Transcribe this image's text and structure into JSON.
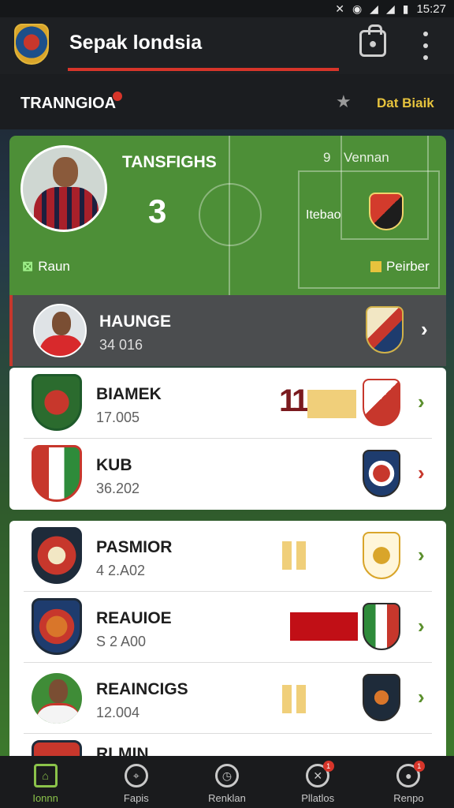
{
  "status_bar": {
    "time": "15:27",
    "icons": [
      "mute-icon",
      "wifi-icon",
      "signal-icon",
      "signal-icon",
      "battery-icon"
    ]
  },
  "app_bar": {
    "title": "Sepak londsia",
    "logo_icon": "club-crest-icon",
    "action_icon": "bag-icon",
    "menu_icon": "more-vertical-icon"
  },
  "section": {
    "title": "TRANNGIOA",
    "star_icon": "star-icon",
    "action": "Dat Biaik"
  },
  "feature": {
    "label": "TANSFIGHS",
    "count": "3",
    "link": "Raun",
    "number": "9",
    "name": "Vennan",
    "sub": "Itebao",
    "action": "Peirber",
    "colors": {
      "card": "#4d8f37",
      "accent": "#e7c33d"
    }
  },
  "rows": [
    {
      "name": "HAUNGE",
      "value": "34 016",
      "chevron_color": "#ffffff"
    },
    {
      "name": "BIAMEK",
      "value": "17.005",
      "chevron_color": "#5b8f2d",
      "stat": "11"
    },
    {
      "name": "KUB",
      "value": "36.202",
      "chevron_color": "#c7372c"
    },
    {
      "name": "PASMIOR",
      "value": "4 2.A02",
      "chevron_color": "#5b8f2d"
    },
    {
      "name": "REAUIOE",
      "value": "S 2 A00",
      "chevron_color": "#5b8f2d"
    },
    {
      "name": "REAINCIGS",
      "value": "12.004",
      "chevron_color": "#5b8f2d"
    },
    {
      "name": "RLMIN",
      "value": ""
    }
  ],
  "bottom_nav": [
    {
      "label": "Ionnn",
      "icon": "home-icon",
      "active": true
    },
    {
      "label": "Fapis",
      "icon": "location-icon",
      "active": false
    },
    {
      "label": "Renklan",
      "icon": "search-icon",
      "active": false
    },
    {
      "label": "Pllatlos",
      "icon": "tactics-icon",
      "active": false,
      "badge": "1"
    },
    {
      "label": "Renpo",
      "icon": "gamepad-icon",
      "active": false,
      "badge": "1"
    }
  ]
}
